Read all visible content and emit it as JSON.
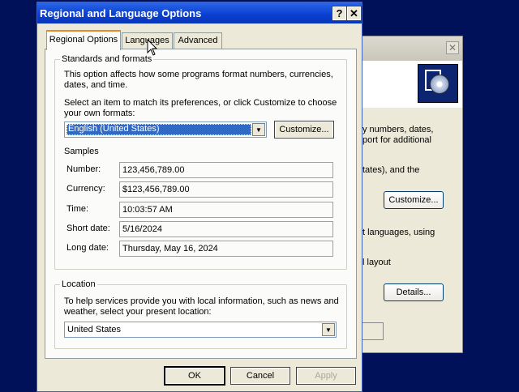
{
  "background_window": {
    "line1": "y numbers, dates,",
    "line2": "port for additional",
    "line3": "tates), and the",
    "customize_label": "Customize...",
    "line4": "t languages, using",
    "line5": "l layout",
    "details_label": "Details..."
  },
  "dialog": {
    "title": "Regional and Language Options",
    "help_label": "?",
    "close_label": "✕",
    "tabs": [
      {
        "label": "Regional Options",
        "active": true
      },
      {
        "label": "Languages",
        "active": false
      },
      {
        "label": "Advanced",
        "active": false
      }
    ],
    "standards": {
      "legend": "Standards and formats",
      "desc_line1": "This option affects how some programs format numbers, currencies,",
      "desc_line2": "dates, and time.",
      "select_line1": "Select an item to match its preferences, or click Customize to choose",
      "select_line2": "your own formats:",
      "locale_value": "English (United States)",
      "customize_label": "Customize...",
      "samples_label": "Samples",
      "samples": [
        {
          "label": "Number:",
          "value": "123,456,789.00"
        },
        {
          "label": "Currency:",
          "value": "$123,456,789.00"
        },
        {
          "label": "Time:",
          "value": "10:03:57 AM"
        },
        {
          "label": "Short date:",
          "value": "5/16/2024"
        },
        {
          "label": "Long date:",
          "value": "Thursday, May 16, 2024"
        }
      ]
    },
    "location": {
      "legend": "Location",
      "desc_line1": "To help services provide you with local information, such as news and",
      "desc_line2": "weather, select your present location:",
      "value": "United States"
    },
    "buttons": {
      "ok": "OK",
      "cancel": "Cancel",
      "apply": "Apply"
    }
  },
  "icons": [
    "dropdown-arrow-icon",
    "cd-package-icon",
    "mouse-cursor-icon"
  ]
}
